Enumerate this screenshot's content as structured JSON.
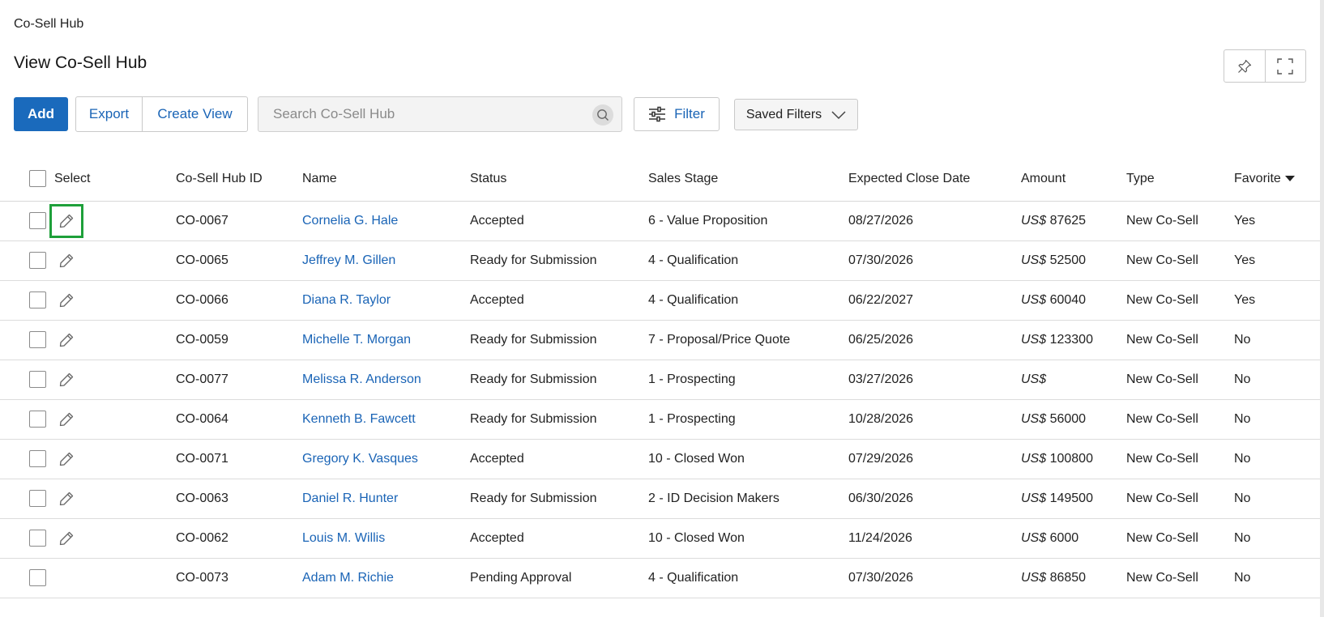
{
  "breadcrumb": "Co-Sell Hub",
  "page_title": "View Co-Sell Hub",
  "toolbar": {
    "add_label": "Add",
    "export_label": "Export",
    "create_view_label": "Create View",
    "filter_label": "Filter",
    "saved_filters_label": "Saved Filters"
  },
  "search": {
    "placeholder": "Search Co-Sell Hub",
    "value": ""
  },
  "window_icons": [
    "pin-icon",
    "fullscreen-icon"
  ],
  "table": {
    "columns": {
      "select": "Select",
      "id": "Co-Sell Hub ID",
      "name": "Name",
      "status": "Status",
      "stage": "Sales Stage",
      "date": "Expected Close Date",
      "amount": "Amount",
      "type": "Type",
      "favorite": "Favorite"
    },
    "currency": "US$",
    "rows": [
      {
        "id": "CO-0067",
        "name": "Cornelia G. Hale",
        "status": "Accepted",
        "stage": "6 - Value Proposition",
        "date": "08/27/2026",
        "amount": "87625",
        "type": "New Co-Sell",
        "favorite": "Yes",
        "editable": true
      },
      {
        "id": "CO-0065",
        "name": "Jeffrey M. Gillen",
        "status": "Ready for Submission",
        "stage": "4 - Qualification",
        "date": "07/30/2026",
        "amount": "52500",
        "type": "New Co-Sell",
        "favorite": "Yes",
        "editable": true
      },
      {
        "id": "CO-0066",
        "name": "Diana R. Taylor",
        "status": "Accepted",
        "stage": "4 - Qualification",
        "date": "06/22/2027",
        "amount": "60040",
        "type": "New Co-Sell",
        "favorite": "Yes",
        "editable": true
      },
      {
        "id": "CO-0059",
        "name": "Michelle T. Morgan",
        "status": "Ready for Submission",
        "stage": "7 - Proposal/Price Quote",
        "date": "06/25/2026",
        "amount": "123300",
        "type": "New Co-Sell",
        "favorite": "No",
        "editable": true
      },
      {
        "id": "CO-0077",
        "name": "Melissa R. Anderson",
        "status": "Ready for Submission",
        "stage": "1 - Prospecting",
        "date": "03/27/2026",
        "amount": "",
        "type": "New Co-Sell",
        "favorite": "No",
        "editable": true
      },
      {
        "id": "CO-0064",
        "name": "Kenneth B. Fawcett",
        "status": "Ready for Submission",
        "stage": "1 - Prospecting",
        "date": "10/28/2026",
        "amount": "56000",
        "type": "New Co-Sell",
        "favorite": "No",
        "editable": true
      },
      {
        "id": "CO-0071",
        "name": "Gregory K. Vasques",
        "status": "Accepted",
        "stage": "10 - Closed Won",
        "date": "07/29/2026",
        "amount": "100800",
        "type": "New Co-Sell",
        "favorite": "No",
        "editable": true
      },
      {
        "id": "CO-0063",
        "name": "Daniel R. Hunter",
        "status": "Ready for Submission",
        "stage": "2 - ID Decision Makers",
        "date": "06/30/2026",
        "amount": "149500",
        "type": "New Co-Sell",
        "favorite": "No",
        "editable": true
      },
      {
        "id": "CO-0062",
        "name": "Louis M. Willis",
        "status": "Accepted",
        "stage": "10 - Closed Won",
        "date": "11/24/2026",
        "amount": "6000",
        "type": "New Co-Sell",
        "favorite": "No",
        "editable": true
      },
      {
        "id": "CO-0073",
        "name": "Adam M. Richie",
        "status": "Pending Approval",
        "stage": "4 - Qualification",
        "date": "07/30/2026",
        "amount": "86850",
        "type": "New Co-Sell",
        "favorite": "No",
        "editable": false
      }
    ]
  },
  "colors": {
    "accent": "#1a6abc",
    "link": "#1a64b6",
    "focus": "#1ea03a"
  }
}
